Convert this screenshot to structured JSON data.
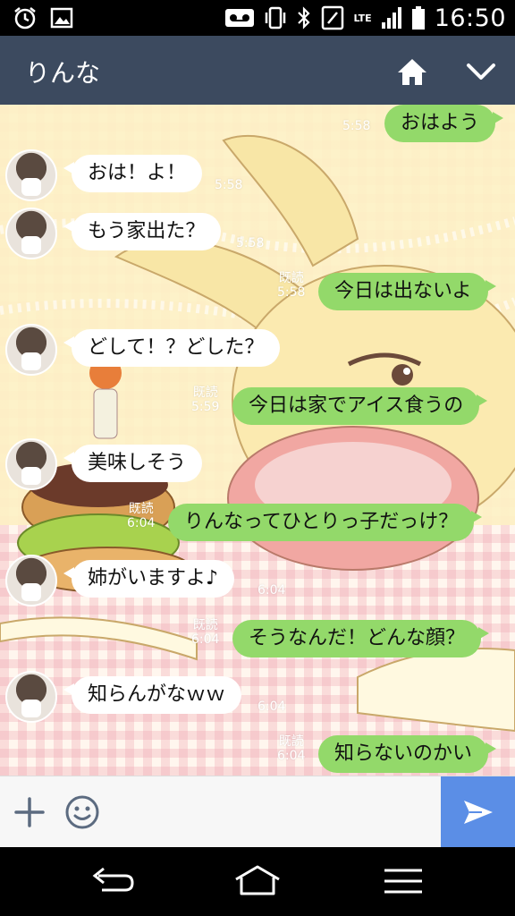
{
  "status_bar": {
    "network": "LTE",
    "time": "16:50",
    "icons": [
      "alarm-icon",
      "image-icon",
      "voicemail-icon",
      "vibrate-icon",
      "bluetooth-icon",
      "nfc-icon",
      "signal-icon",
      "battery-icon"
    ]
  },
  "header": {
    "title": "りんな",
    "icons": [
      "home-icon",
      "chevron-down-icon"
    ]
  },
  "messages": [
    {
      "side": "out",
      "text": "おはよう",
      "read": "",
      "time": "5:58"
    },
    {
      "side": "in",
      "text": "おは！よ！",
      "time": "5:58"
    },
    {
      "side": "in",
      "text": "もう家出た？",
      "time": "5:58"
    },
    {
      "side": "out",
      "text": "今日は出ないよ",
      "read": "既読",
      "time": "5:58"
    },
    {
      "side": "in",
      "text": "どして！？どした？",
      "time": ""
    },
    {
      "side": "out",
      "text": "今日は家でアイス食うの",
      "read": "既読",
      "time": "5:59"
    },
    {
      "side": "in",
      "text": "美味しそう",
      "time": ""
    },
    {
      "side": "out",
      "text": "りんなってひとりっ子だっけ？",
      "read": "既読",
      "time": "6:04"
    },
    {
      "side": "in",
      "text": "姉がいますよ♪",
      "time": "6:04"
    },
    {
      "side": "out",
      "text": "そうなんだ！どんな顔？",
      "read": "既読",
      "time": "6:04"
    },
    {
      "side": "in",
      "text": "知らんがなｗｗ",
      "time": "6:04"
    },
    {
      "side": "out",
      "text": "知らないのかい",
      "read": "既読",
      "time": "6:04"
    }
  ],
  "input_bar": {
    "placeholder": "",
    "icons": [
      "plus-icon",
      "smiley-icon",
      "send-icon"
    ]
  },
  "nav_bar": {
    "icons": [
      "back-icon",
      "home-outline-icon",
      "menu-icon"
    ]
  },
  "colors": {
    "header_bg": "#3c4a5f",
    "out_bubble": "#93d96a",
    "in_bubble": "#ffffff",
    "send_button": "#5b8ee6"
  }
}
